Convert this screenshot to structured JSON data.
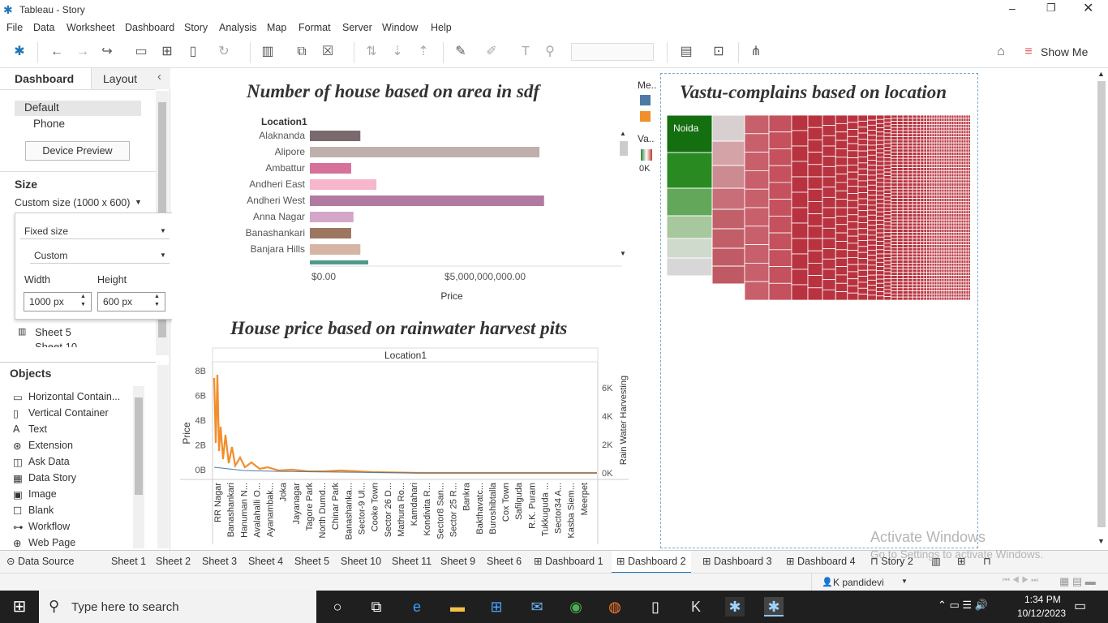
{
  "app": {
    "title": "Tableau - Story"
  },
  "menu": [
    "File",
    "Data",
    "Worksheet",
    "Dashboard",
    "Story",
    "Analysis",
    "Map",
    "Format",
    "Server",
    "Window",
    "Help"
  ],
  "toolbar": {
    "show_me": "Show Me"
  },
  "left": {
    "tab_dashboard": "Dashboard",
    "tab_layout": "Layout",
    "device_default": "Default",
    "device_phone": "Phone",
    "device_preview": "Device Preview",
    "size_header": "Size",
    "size_value": "Custom size (1000 x 600)",
    "fixed_size": "Fixed size",
    "custom": "Custom",
    "width_label": "Width",
    "height_label": "Height",
    "width_value": "1000 px",
    "height_value": "600 px",
    "sheet5": "Sheet 5",
    "sheet10": "Sheet 10",
    "objects_header": "Objects",
    "objects": [
      "Horizontal Contain...",
      "Vertical Container",
      "Text",
      "Extension",
      "Ask Data",
      "Data Story",
      "Image",
      "Blank",
      "Workflow",
      "Web Page"
    ]
  },
  "bar_chart": {
    "title": "Number of house based on area in sdf",
    "header": "Location1"
  },
  "line_chart": {
    "title": "House price based on rainwater harvest pits",
    "header": "Location1"
  },
  "treemap": {
    "title": "Vastu-complains based on location",
    "label": "Noida"
  },
  "legend": {
    "me": "Me..",
    "va": "Va..",
    "range": "0K"
  },
  "chart_data": [
    {
      "type": "bar",
      "categories": [
        "Alaknanda",
        "Alipore",
        "Ambattur",
        "Andheri East",
        "Andheri West",
        "Anna Nagar",
        "Banashankari",
        "Banjara Hills"
      ],
      "values": [
        1100000000,
        5000000000,
        900000000,
        1450000000,
        5100000000,
        950000000,
        900000000,
        1100000000
      ],
      "colors": [
        "#7a6a6e",
        "#bfb0ae",
        "#d6729a",
        "#f7b6cc",
        "#b07aa1",
        "#d4a6c8",
        "#9d7660",
        "#d7b5a6"
      ],
      "xlabel": "Price",
      "xticks": [
        "$0.00",
        "$5,000,000,000.00"
      ],
      "xlim": [
        0,
        6800000000
      ]
    },
    {
      "type": "line",
      "xlabel": "Location1",
      "ylabel": "Price",
      "y2label": "Rain Water Harvesting",
      "yticks": [
        "8B",
        "6B",
        "4B",
        "2B",
        "0B"
      ],
      "y2ticks": [
        "6K",
        "4K",
        "2K",
        "0K"
      ],
      "categories": [
        "RR Nagar",
        "Banashankari",
        "Hanuman N...",
        "Avalahalli O...",
        "Ayanambak...",
        "Joka",
        "Jayanagar",
        "Tagore Park",
        "North Dumd...",
        "Chinar Park",
        "Banashanka...",
        "Sector-9 Ul...",
        "Cooke Town",
        "Sector 26 D...",
        "Mathura Ro...",
        "Kamdahari",
        "Kondivita R...",
        "Sector8 San...",
        "Sector 25 R...",
        "Bankra",
        "Bakthavatc...",
        "Buroshibtalla",
        "Cox Town",
        "Safilguda",
        "R.K. Puram",
        "Tukkuguda ...",
        "Sector34 A...",
        "Kasba Siem...",
        "Meerpet"
      ]
    }
  ],
  "tabs": [
    "Data Source",
    "Sheet 1",
    "Sheet 2",
    "Sheet 3",
    "Sheet 4",
    "Sheet 5",
    "Sheet 10",
    "Sheet 11",
    "Sheet 9",
    "Sheet 6",
    "Dashboard 1",
    "Dashboard 2",
    "Dashboard 3",
    "Dashboard 4",
    "Story 2"
  ],
  "status": {
    "user": "K pandidevi"
  },
  "watermark": {
    "line1": "Activate Windows",
    "line2": "Go to Settings to activate Windows."
  },
  "taskbar": {
    "search": "Type here to search",
    "time": "1:34 PM",
    "date": "10/12/2023"
  }
}
